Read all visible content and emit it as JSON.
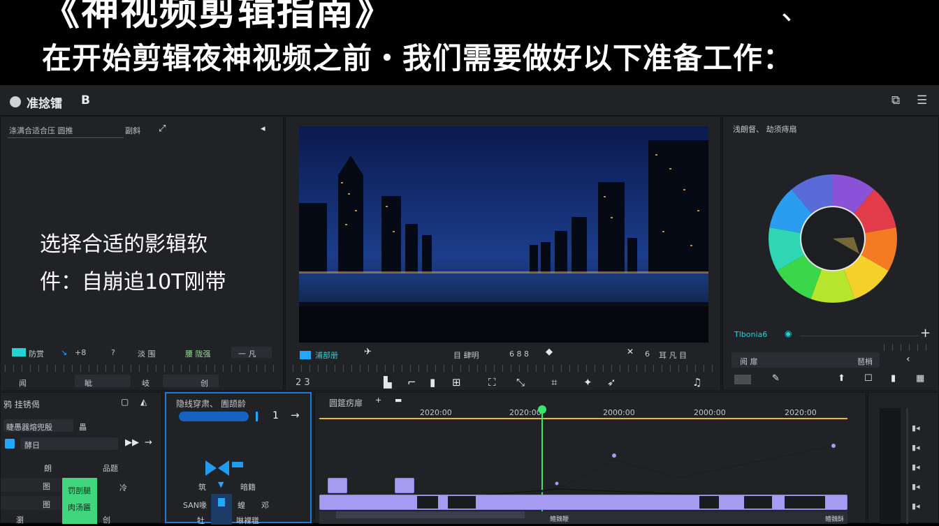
{
  "banner": {
    "title": "《神视频剪辑指南》",
    "title_tail": "、",
    "subtitle": "在开始剪辑夜神视频之前・我们需要做好以下准备工作："
  },
  "app": {
    "name": "准捻镭",
    "name_suffix": "B",
    "titlebar_icons": [
      "window-icon",
      "menu-icon"
    ]
  },
  "left_panel": {
    "header_label": "涤满合适合压 圆推",
    "header_right": "副斜",
    "overlay_line1": "选择合适的影辑软",
    "overlay_line2": "件：自崩追10T刚带",
    "bottom_labels": [
      "防赏",
      "+8",
      "?",
      "淡 围",
      "腰 陇强",
      "一 凡"
    ],
    "strip_labels": [
      "闻",
      "眦",
      "岐",
      "创"
    ]
  },
  "preview": {
    "label": "浦部册",
    "controls": [
      "目 肆明",
      "6 8 8",
      "6",
      "耳 凡 目"
    ],
    "toolbar_left": "2 3",
    "toolbar_icons": [
      "crop-icon",
      "trim-icon",
      "split-icon",
      "merge-icon",
      "cut-icon",
      "move-icon",
      "speed-icon",
      "arrow-icon",
      "audio-icon"
    ]
  },
  "color_panel": {
    "header": "浅朗督、 劫须痔扇",
    "label": "Tlbonia6",
    "row_left": "阅 扉",
    "row_right": "琶梢",
    "wheel_colors": [
      "#8a52d6",
      "#e23c4a",
      "#f47a24",
      "#f3d12a",
      "#b7e42c",
      "#3cd64a",
      "#2ed6b4",
      "#2a9df0",
      "#5a6bd8"
    ]
  },
  "bottom_left": {
    "header": "鸦 挂锈偈",
    "field_label": "睫愚器熔兜殷",
    "field_btn": "畾",
    "row_label": "酵日",
    "rows": [
      "图",
      "图",
      "瀏"
    ],
    "green_block": "罚剖腿",
    "green_caption": "肉汤匾",
    "labels": [
      "朗",
      "品题",
      "创",
      "冷"
    ]
  },
  "inspector": {
    "header": "隐线穿肃、 圊颉龄",
    "value": "1",
    "labels": [
      "筑",
      "暗籍",
      "SAN喙",
      "蝗",
      "邓",
      "啉裸氆",
      "牡",
      "硼鸿"
    ]
  },
  "timeline": {
    "header": "圆筵疠扉",
    "timecodes": [
      "2020:00",
      "2020:00",
      "2000:00",
      "2000:00",
      "2020:00"
    ],
    "playhead_color": "#3be46b",
    "track_color": "#a59cf2",
    "bottom_labels": [
      "鳢魏鞭",
      "鳢魏酥"
    ]
  }
}
